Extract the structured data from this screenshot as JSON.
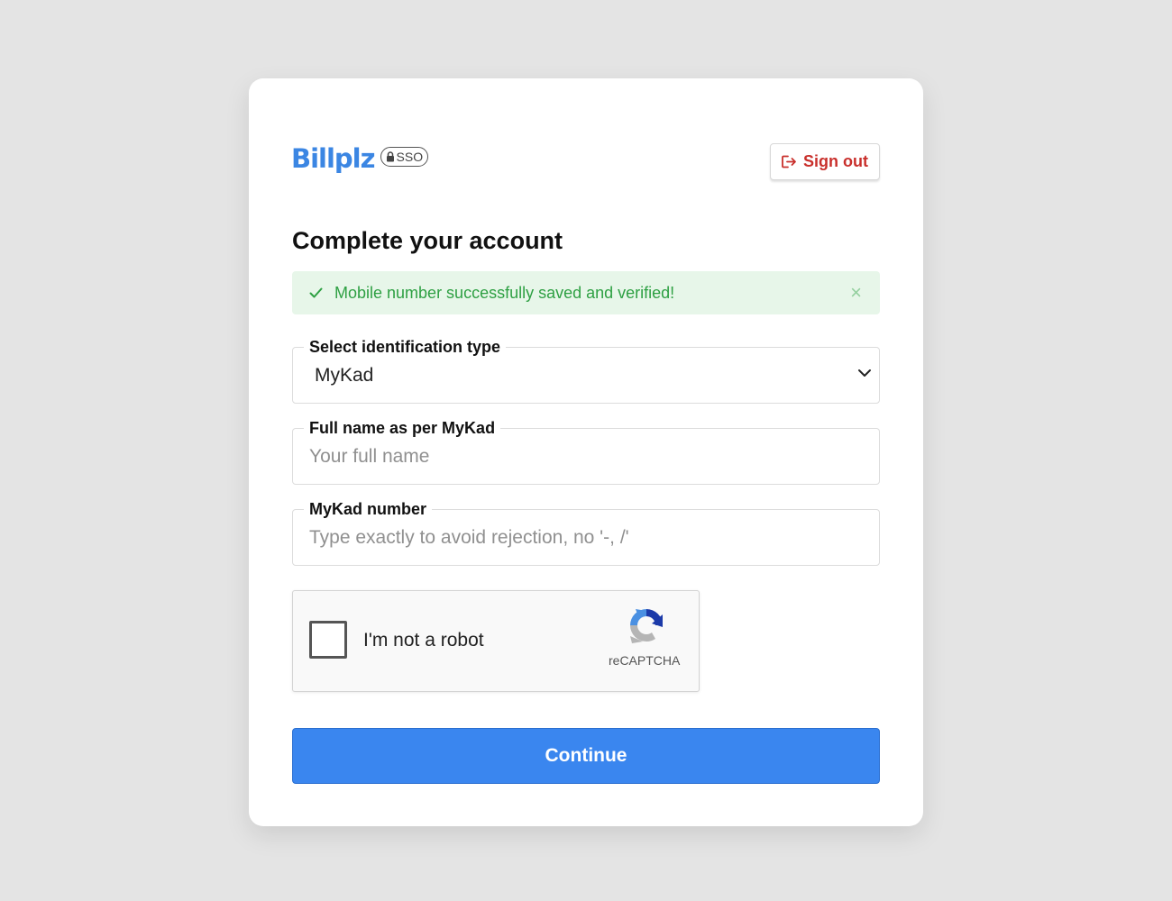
{
  "header": {
    "logo_text": "Billplz",
    "badge_text": "SSO",
    "signout_label": "Sign out"
  },
  "page": {
    "title": "Complete your account"
  },
  "alert": {
    "message": "Mobile number successfully saved and verified!",
    "close_glyph": "×"
  },
  "form": {
    "id_type": {
      "label": "Select identification type",
      "value": "MyKad"
    },
    "full_name": {
      "label": "Full name as per MyKad",
      "placeholder": "Your full name"
    },
    "id_number": {
      "label": "MyKad number",
      "placeholder": "Type exactly to avoid rejection, no '-, /'"
    }
  },
  "recaptcha": {
    "label": "I'm not a robot",
    "brand": "reCAPTCHA"
  },
  "submit": {
    "label": "Continue"
  },
  "colors": {
    "brand_blue": "#3b86e3",
    "signout_red": "#c9302c",
    "success_green": "#2ea043",
    "success_bg": "#e7f6e9",
    "button_blue": "#3a86ef",
    "page_bg": "#e4e4e4"
  },
  "icons": {
    "signout": "sign-out-icon",
    "lock": "lock-icon",
    "check": "check-icon",
    "close": "close-icon",
    "dropdown": "chevron-down-icon",
    "recaptcha": "recaptcha-logo-icon"
  }
}
